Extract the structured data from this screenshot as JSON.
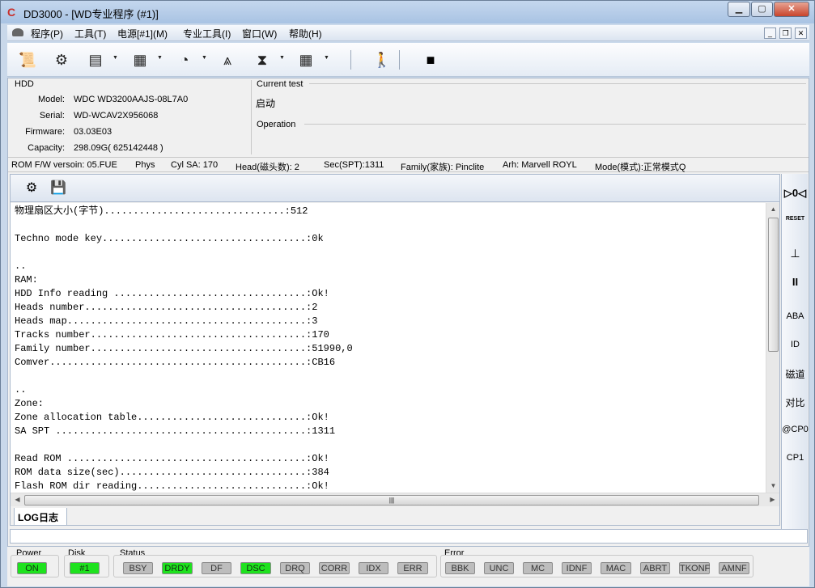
{
  "window": {
    "title": "DD3000 - [WD专业程序 (#1)]",
    "app_icon": "C"
  },
  "menu": {
    "items": [
      "程序(P)",
      "工具(T)",
      "电源[#1](M)",
      "专业工具(I)",
      "窗口(W)",
      "帮助(H)"
    ]
  },
  "toolbar": {
    "icons": [
      "scroll-icon",
      "gear-globe-icon",
      "drive-config-icon",
      "chip-icon",
      "disk-icon",
      "pyramid-icon",
      "hourglass-icon",
      "grid-icon",
      "exit-icon",
      "stop-icon"
    ]
  },
  "hdd": {
    "title": "HDD",
    "model_label": "Model:",
    "model": "WDC WD3200AAJS-08L7A0",
    "serial_label": "Serial:",
    "serial": "WD-WCAV2X956068",
    "firmware_label": "Firmware:",
    "firmware": "03.03E03",
    "capacity_label": "Capacity:",
    "capacity": "298.09G( 625142448 )"
  },
  "current_test": {
    "title": "Current test",
    "value": "启动"
  },
  "operation": {
    "title": "Operation"
  },
  "infobar": {
    "rom": "ROM F/W versoin: 05.FUE",
    "phys": "Phys",
    "cyl": "Cyl SA: 170",
    "heads": "Head(磁头数): 2",
    "sec": "Sec(SPT):1311",
    "family": "Family(家族): Pinclite",
    "arh": "Arh: Marvell ROYL",
    "mode": "Mode(模式):正常模式Q"
  },
  "log": {
    "tab": "LOG日志",
    "lines": [
      "物理扇区大小(字节)...............................:512",
      "",
      "Techno mode key...................................:0k",
      "",
      "..",
      "RAM:",
      "HDD Info reading .................................:Ok!",
      "Heads number......................................:2",
      "Heads map.........................................:3",
      "Tracks number.....................................:170",
      "Family number.....................................:51990,0",
      "Comver............................................:CB16",
      "",
      "..",
      "Zone:",
      "Zone allocation table.............................:Ok!",
      "SA SPT ...........................................:1311",
      "",
      "Read ROM .........................................:Ok!",
      "ROM data size(sec)................................:384",
      "Flash ROM dir reading.............................:Ok!"
    ]
  },
  "right_panel": {
    "buttons": [
      "▷0◁",
      "RESET",
      "⊥",
      "II",
      "ABA",
      "ID",
      "磁道",
      "对比",
      "@CP0",
      "CP1"
    ]
  },
  "bottom": {
    "power": {
      "title": "Power",
      "leds": [
        {
          "label": "ON",
          "on": true
        }
      ]
    },
    "disk": {
      "title": "Disk",
      "leds": [
        {
          "label": "#1",
          "on": true
        }
      ]
    },
    "status": {
      "title": "Status",
      "leds": [
        {
          "label": "BSY",
          "on": false
        },
        {
          "label": "DRDY",
          "on": true
        },
        {
          "label": "DF",
          "on": false
        },
        {
          "label": "DSC",
          "on": true
        },
        {
          "label": "DRQ",
          "on": false
        },
        {
          "label": "CORR",
          "on": false
        },
        {
          "label": "IDX",
          "on": false
        },
        {
          "label": "ERR",
          "on": false
        }
      ]
    },
    "error": {
      "title": "Error",
      "leds": [
        {
          "label": "BBK",
          "on": false
        },
        {
          "label": "UNC",
          "on": false
        },
        {
          "label": "MC",
          "on": false
        },
        {
          "label": "IDNF",
          "on": false
        },
        {
          "label": "MAC",
          "on": false
        },
        {
          "label": "ABRT",
          "on": false
        },
        {
          "label": "TKONF",
          "on": false
        },
        {
          "label": "AMNF",
          "on": false
        }
      ]
    }
  }
}
